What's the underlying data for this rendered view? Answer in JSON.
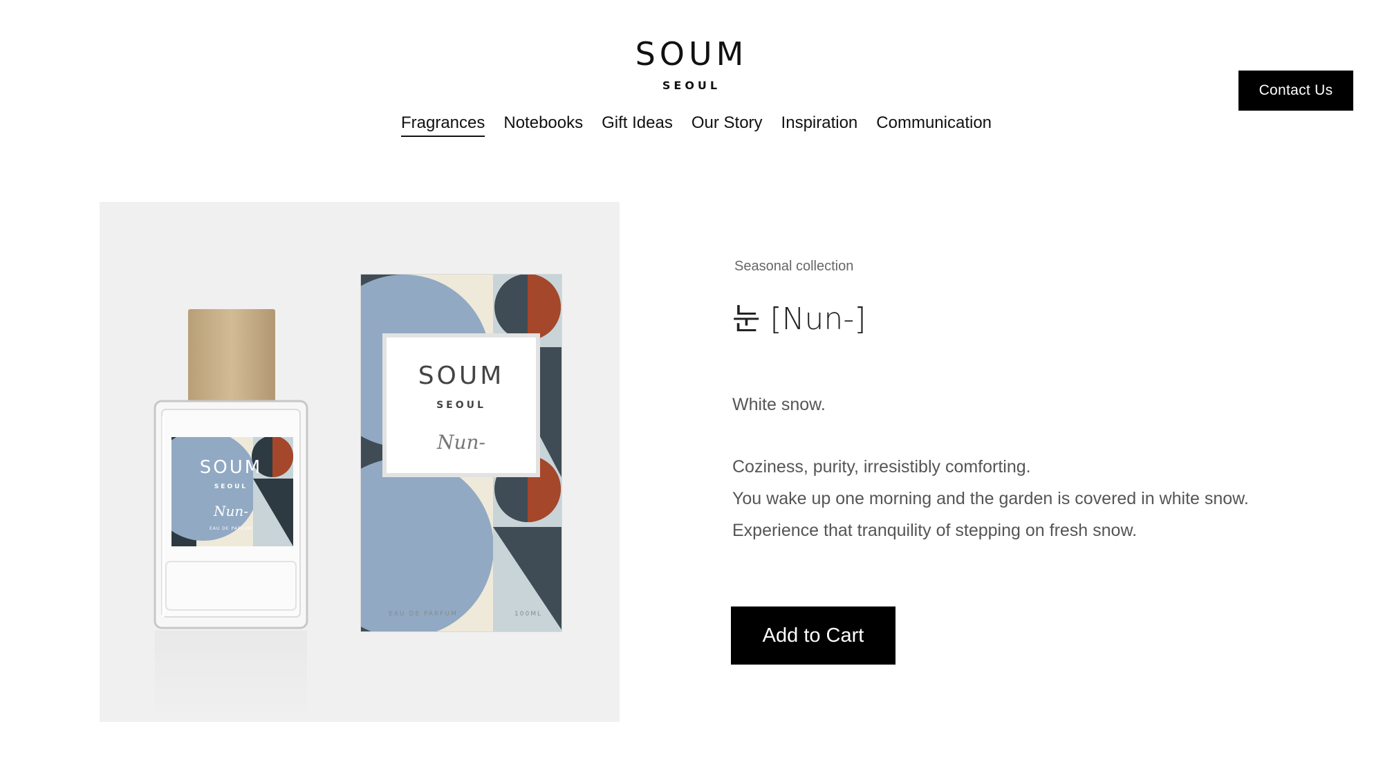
{
  "header": {
    "logo_word": "SOUM",
    "logo_city": "SEOUL",
    "contact_label": "Contact Us"
  },
  "nav": {
    "items": [
      {
        "label": "Fragrances",
        "active": true
      },
      {
        "label": "Notebooks"
      },
      {
        "label": "Gift Ideas"
      },
      {
        "label": "Our Story"
      },
      {
        "label": "Inspiration"
      },
      {
        "label": "Communication"
      }
    ]
  },
  "product": {
    "collection": "Seasonal collection",
    "title": "눈 [Nun-]",
    "tagline": "White snow.",
    "lines": [
      "Coziness, purity, irresistibly comforting.",
      "You wake up one morning and the garden is covered in white snow.",
      "Experience that tranquility of stepping on fresh snow."
    ],
    "cart_label": "Add to Cart",
    "image": {
      "brand": "SOUM",
      "city": "SEOUL",
      "scent": "Nun-",
      "type": "EAU DE PARFUM",
      "volume": "100ML",
      "colors": {
        "slate": "#3f4c55",
        "blue": "#91a9c3",
        "cream": "#efe9da",
        "rust": "#a5472a",
        "pale": "#c8d4d8",
        "wood": "#c4ab84"
      }
    }
  }
}
